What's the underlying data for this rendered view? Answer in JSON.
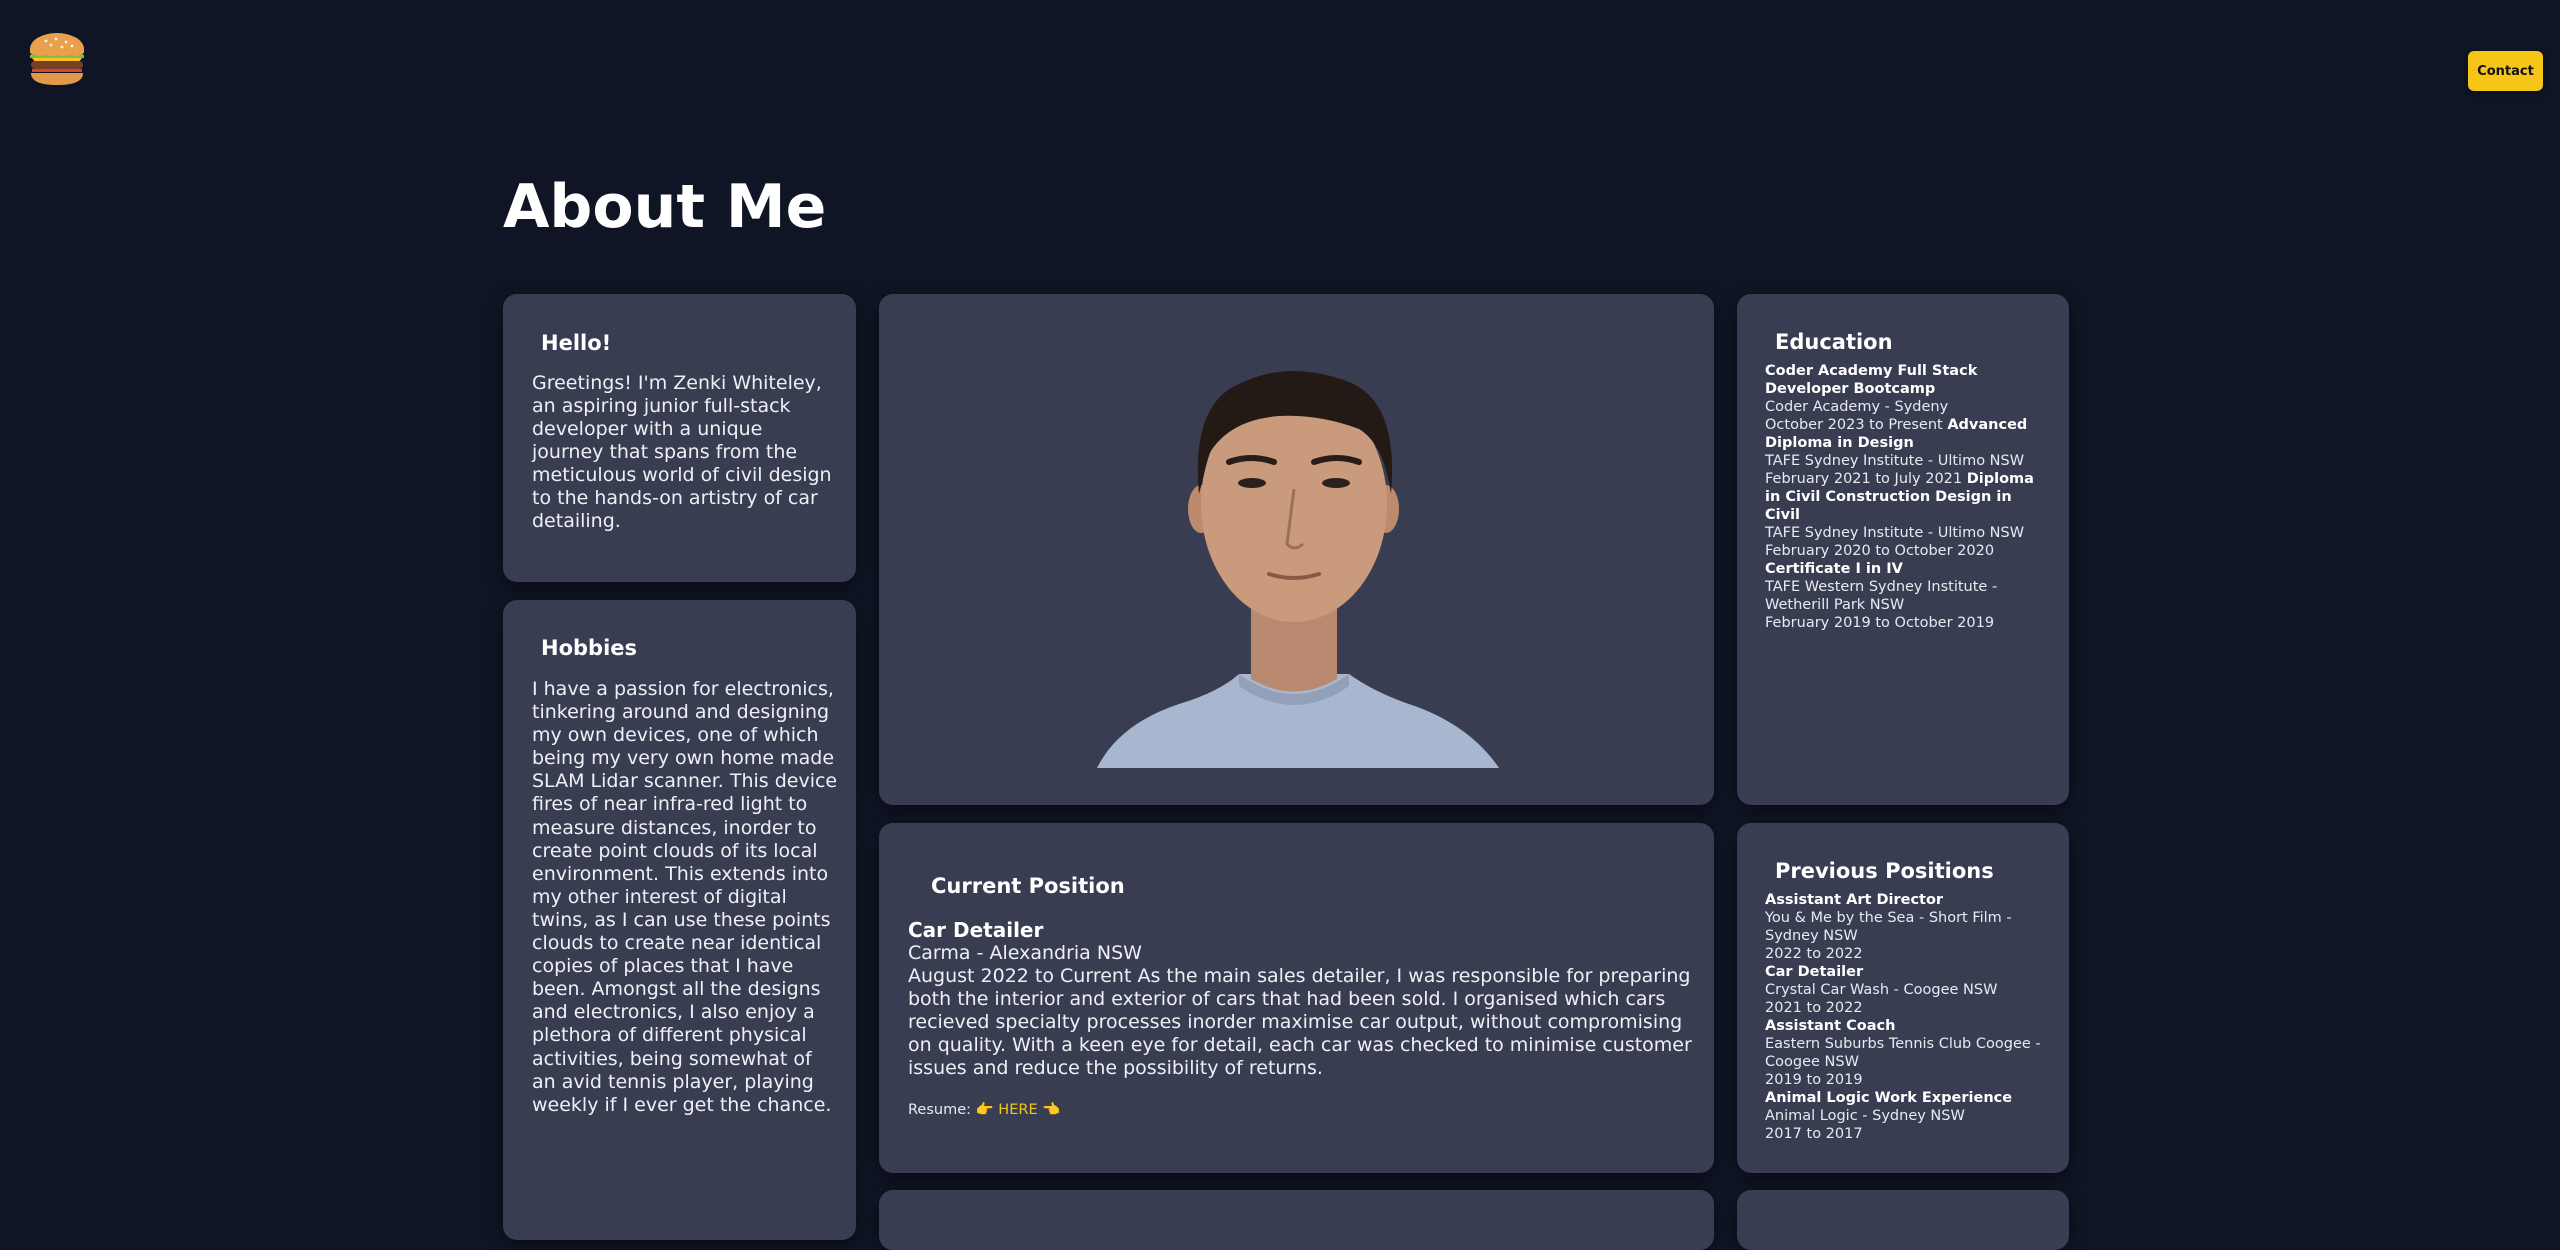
{
  "header": {
    "logo_icon": "hamburger-emoji-icon",
    "contact_label": "Contact",
    "accent_color": "#f5c518"
  },
  "page": {
    "title": "About Me"
  },
  "hello": {
    "heading": "Hello!",
    "text": "Greetings! I'm Zenki Whiteley, an aspiring junior full-stack developer with a unique journey that spans from the meticulous world of civil design to the hands-on artistry of car detailing."
  },
  "hobbies": {
    "heading": "Hobbies",
    "text": "I have a passion for electronics, tinkering around and designing my own devices, one of which being my very own home made SLAM Lidar scanner. This device fires of near infra-red light to measure distances, inorder to create point clouds of its local environment. This extends into my other interest of digital twins, as I can use these points clouds to create near identical copies of places that I have been. Amongst all the designs and electronics, I also enjoy a plethora of different physical activities, being somewhat of an avid tennis player, playing weekly if I ever get the chance."
  },
  "photo": {
    "alt": "portrait-photo"
  },
  "education": {
    "heading": "Education",
    "items": [
      {
        "title": "Coder Academy Full Stack Developer Bootcamp",
        "place": "Coder Academy - Sydeny",
        "dates": "October 2023 to Present"
      },
      {
        "title": "Advanced Diploma in Design",
        "place": "TAFE Sydney Institute - Ultimo NSW",
        "dates": "February 2021 to July 2021"
      },
      {
        "title": "Diploma in Civil Construction Design in Civil",
        "place": "TAFE Sydney Institute - Ultimo NSW",
        "dates": "February 2020 to October 2020"
      },
      {
        "title": "Certificate I in IV",
        "place": "TAFE Western Sydney Institute - Wetherill Park NSW",
        "dates": "February 2019 to October 2019"
      }
    ]
  },
  "current_position": {
    "heading": "Current Position",
    "title": "Car Detailer",
    "company": "Carma - Alexandria NSW",
    "dates": "August 2022 to Current",
    "description": "As the main sales detailer, I was responsible for preparing both the interior and exterior of cars that had been sold. I organised which cars recieved specialty processes inorder maximise car output, without compromising on quality. With a keen eye for detail, each car was checked to minimise customer issues and reduce the possibility of returns.",
    "resume_label": "Resume:",
    "resume_link": "👉 HERE 👈"
  },
  "previous_positions": {
    "heading": "Previous Positions",
    "items": [
      {
        "title": "Assistant Art Director",
        "place": "You & Me by the Sea - Short Film - Sydney NSW",
        "dates": "2022 to 2022"
      },
      {
        "title": "Car Detailer",
        "place": "Crystal Car Wash - Coogee NSW",
        "dates": "2021 to 2022"
      },
      {
        "title": "Assistant Coach",
        "place": "Eastern Suburbs Tennis Club Coogee - Coogee NSW",
        "dates": "2019 to 2019"
      },
      {
        "title": "Animal Logic Work Experience",
        "place": "Animal Logic - Sydney NSW",
        "dates": "2017 to 2017"
      }
    ]
  }
}
